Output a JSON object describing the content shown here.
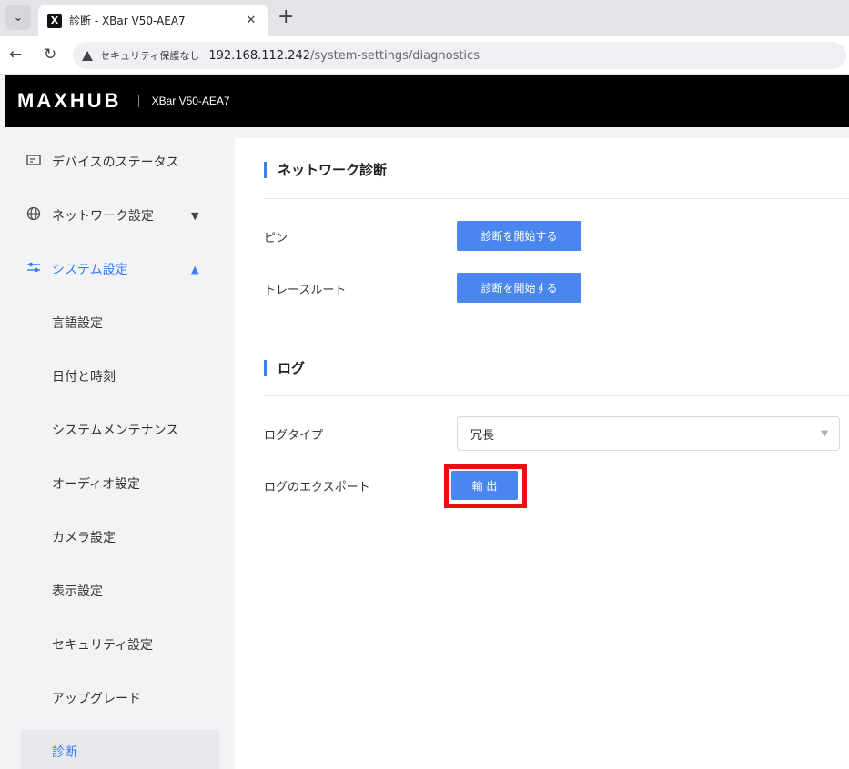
{
  "browser": {
    "tab_title": "診断 - XBar V50-AEA7",
    "favicon_letter": "X",
    "security_label": "セキュリティ保護なし",
    "url_host": "192.168.112.242",
    "url_path": "/system-settings/diagnostics"
  },
  "header": {
    "brand": "MAXHUB",
    "device": "XBar V50-AEA7"
  },
  "sidebar": {
    "items": [
      {
        "label": "デバイスのステータス",
        "icon": "monitor-icon"
      },
      {
        "label": "ネットワーク設定",
        "icon": "globe-icon"
      },
      {
        "label": "システム設定",
        "icon": "sliders-icon"
      }
    ],
    "sub_items": [
      "言語設定",
      "日付と時刻",
      "システムメンテナンス",
      "オーディオ設定",
      "カメラ設定",
      "表示設定",
      "セキュリティ設定",
      "アップグレード",
      "診断"
    ]
  },
  "main": {
    "network_section_title": "ネットワーク診断",
    "ping_label": "ピン",
    "ping_button": "診断を開始する",
    "traceroute_label": "トレースルート",
    "traceroute_button": "診断を開始する",
    "log_section_title": "ログ",
    "log_type_label": "ログタイプ",
    "log_type_value": "冗長",
    "log_export_label": "ログのエクスポート",
    "export_button": "輸 出"
  },
  "colors": {
    "accent": "#3b7ef0",
    "button": "#4a86f0",
    "highlight": "#e81010"
  }
}
